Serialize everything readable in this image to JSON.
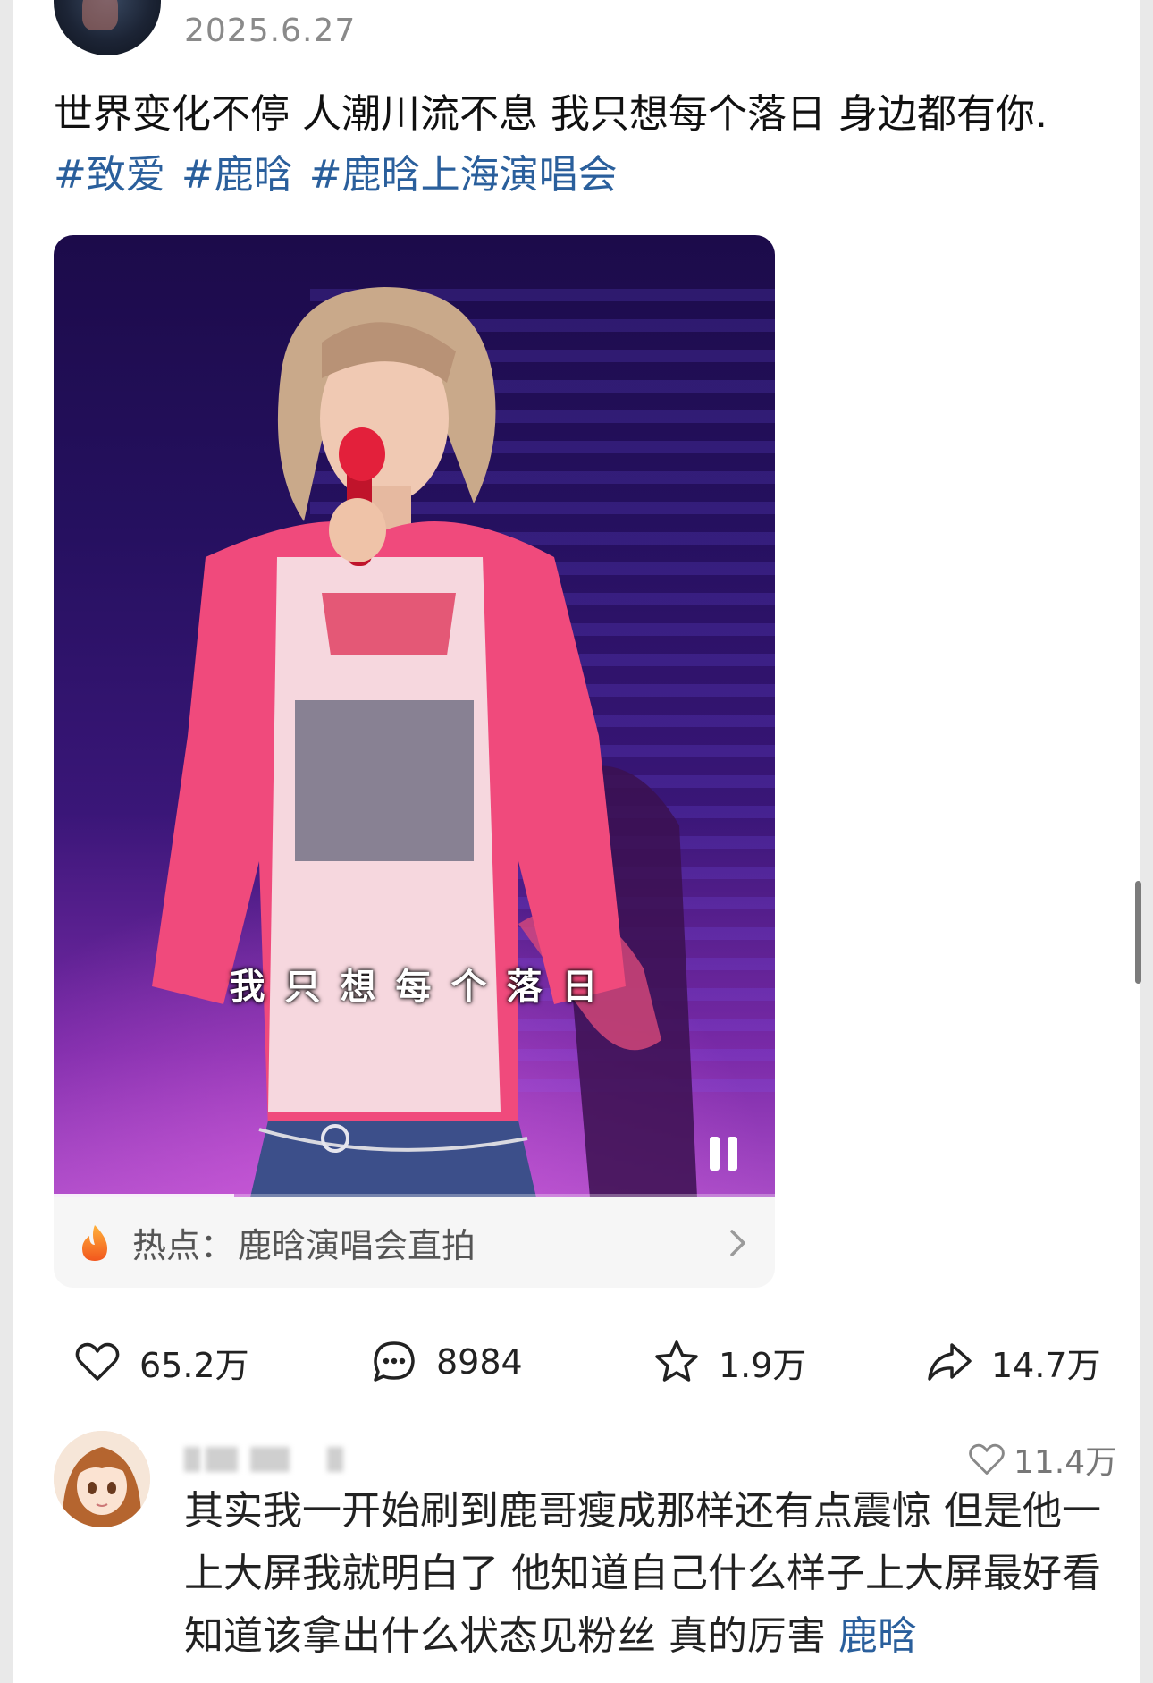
{
  "post": {
    "date": "2025.6.27",
    "text": "世界变化不停 人潮川流不息 我只想每个落日 身边都有你.",
    "hashtags": [
      "#致爱",
      "#鹿晗",
      "#鹿晗上海演唱会"
    ]
  },
  "video": {
    "subtitle": "我只想每个落日",
    "progress": 0.25,
    "pause_icon": "pause-icon"
  },
  "hot": {
    "icon": "flame-icon",
    "label": "热点：",
    "topic": "鹿晗演唱会直拍"
  },
  "actions": {
    "likes": "65.2万",
    "comments": "8984",
    "favorites": "1.9万",
    "shares": "14.7万"
  },
  "comment": {
    "likes": "11.4万",
    "text": "其实我一开始刷到鹿哥瘦成那样还有点震惊 但是他一上大屏我就明白了 他知道自己什么样子上大屏最好看 知道该拿出什么状态见粉丝 真的厉害 ",
    "tag": "鹿晗"
  },
  "colors": {
    "link": "#2a5f9c",
    "background": "#ffffff"
  }
}
